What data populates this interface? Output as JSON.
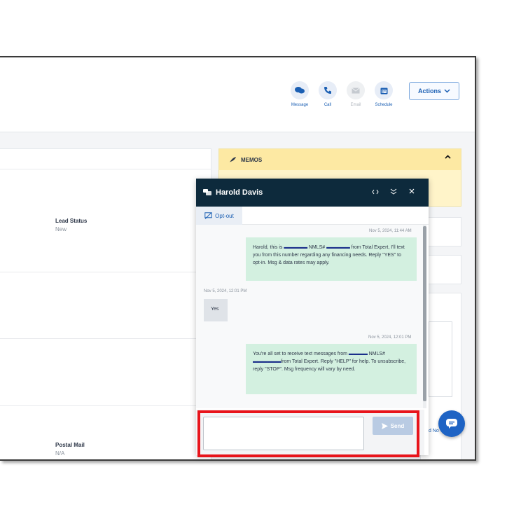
{
  "quick_actions": [
    {
      "label": "Message",
      "icon": "message-bubbles-icon",
      "enabled": true
    },
    {
      "label": "Call",
      "icon": "phone-icon",
      "enabled": true
    },
    {
      "label": "Email",
      "icon": "envelope-icon",
      "enabled": false
    },
    {
      "label": "Schedule",
      "icon": "calendar-icon",
      "enabled": true
    }
  ],
  "actions_button": {
    "label": "Actions"
  },
  "fields": {
    "lead_status": {
      "label": "Lead Status",
      "value": "New"
    },
    "postal_mail": {
      "label": "Postal Mail",
      "value": "N/A"
    }
  },
  "memos": {
    "title": "MEMOS"
  },
  "add_note_partial": "d No",
  "chat": {
    "contact_name": "Harold Davis",
    "optout_label": "Opt-out",
    "messages": [
      {
        "direction": "outbound",
        "timestamp": "Nov 5, 2024, 11:44 AM",
        "parts": [
          "Harold, this is ",
          "",
          " NMLS# ",
          "",
          " from Total Expert, I'll text you from this number regarding any financing needs. Reply \"YES\" to opt-in. Msg & data rates may apply."
        ]
      },
      {
        "direction": "inbound",
        "timestamp": "Nov 5, 2024, 12:01 PM",
        "text": "Yes"
      },
      {
        "direction": "outbound",
        "timestamp": "Nov 5, 2024, 12:01 PM",
        "parts": [
          "You're all set to receive text messages from ",
          "",
          " NMLS# ",
          "",
          "from Total Expert. Reply \"HELP\" for help. To unsubscribe, reply \"STOP\". Msg frequency will vary by need."
        ]
      }
    ],
    "composer": {
      "placeholder": "",
      "send_label": "Send"
    }
  },
  "colors": {
    "header_dark": "#0d2a3c",
    "accent_blue": "#1b5fb3",
    "outbound_bubble": "#d3f0e0",
    "inbound_bubble": "#dfe3e8",
    "highlight_red": "#e8141b",
    "memo_yellow": "#fde9a3"
  }
}
